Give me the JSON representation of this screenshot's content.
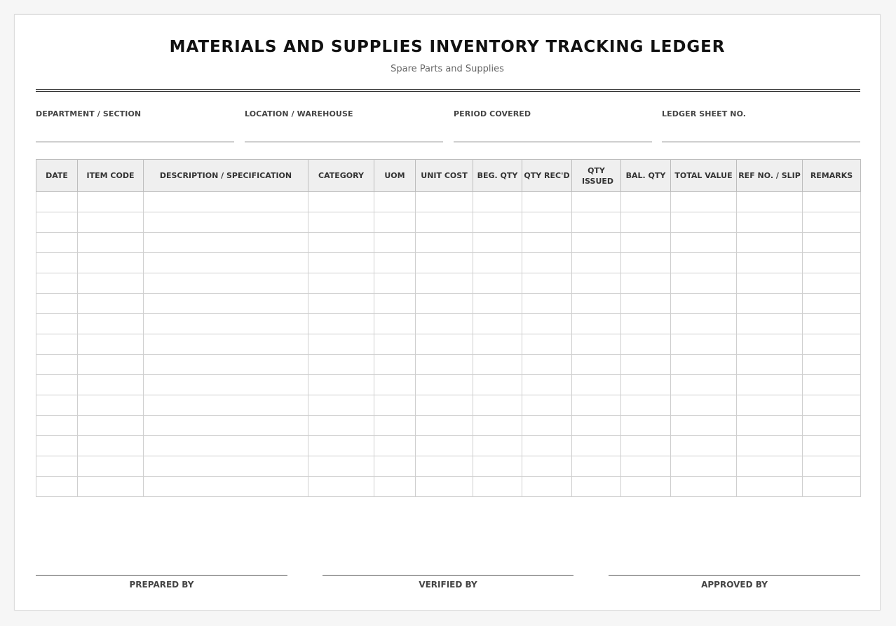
{
  "document": {
    "title": "MATERIALS AND SUPPLIES INVENTORY TRACKING LEDGER",
    "subtitle": "Spare Parts and Supplies"
  },
  "fields": [
    {
      "label": "DEPARTMENT / SECTION",
      "value": ""
    },
    {
      "label": "LOCATION / WAREHOUSE",
      "value": ""
    },
    {
      "label": "PERIOD COVERED",
      "value": ""
    },
    {
      "label": "LEDGER SHEET NO.",
      "value": ""
    }
  ],
  "table": {
    "columns": [
      "DATE",
      "ITEM CODE",
      "DESCRIPTION / SPECIFICATION",
      "CATEGORY",
      "UOM",
      "UNIT COST",
      "BEG. QTY",
      "QTY REC'D",
      "QTY ISSUED",
      "BAL. QTY",
      "TOTAL VALUE",
      "REF NO. / SLIP",
      "REMARKS"
    ],
    "rows": [
      [
        "",
        "",
        "",
        "",
        "",
        "",
        "",
        "",
        "",
        "",
        "",
        "",
        ""
      ],
      [
        "",
        "",
        "",
        "",
        "",
        "",
        "",
        "",
        "",
        "",
        "",
        "",
        ""
      ],
      [
        "",
        "",
        "",
        "",
        "",
        "",
        "",
        "",
        "",
        "",
        "",
        "",
        ""
      ],
      [
        "",
        "",
        "",
        "",
        "",
        "",
        "",
        "",
        "",
        "",
        "",
        "",
        ""
      ],
      [
        "",
        "",
        "",
        "",
        "",
        "",
        "",
        "",
        "",
        "",
        "",
        "",
        ""
      ],
      [
        "",
        "",
        "",
        "",
        "",
        "",
        "",
        "",
        "",
        "",
        "",
        "",
        ""
      ],
      [
        "",
        "",
        "",
        "",
        "",
        "",
        "",
        "",
        "",
        "",
        "",
        "",
        ""
      ],
      [
        "",
        "",
        "",
        "",
        "",
        "",
        "",
        "",
        "",
        "",
        "",
        "",
        ""
      ],
      [
        "",
        "",
        "",
        "",
        "",
        "",
        "",
        "",
        "",
        "",
        "",
        "",
        ""
      ],
      [
        "",
        "",
        "",
        "",
        "",
        "",
        "",
        "",
        "",
        "",
        "",
        "",
        ""
      ],
      [
        "",
        "",
        "",
        "",
        "",
        "",
        "",
        "",
        "",
        "",
        "",
        "",
        ""
      ],
      [
        "",
        "",
        "",
        "",
        "",
        "",
        "",
        "",
        "",
        "",
        "",
        "",
        ""
      ],
      [
        "",
        "",
        "",
        "",
        "",
        "",
        "",
        "",
        "",
        "",
        "",
        "",
        ""
      ],
      [
        "",
        "",
        "",
        "",
        "",
        "",
        "",
        "",
        "",
        "",
        "",
        "",
        ""
      ],
      [
        "",
        "",
        "",
        "",
        "",
        "",
        "",
        "",
        "",
        "",
        "",
        "",
        ""
      ]
    ]
  },
  "signatures": [
    {
      "label": "PREPARED BY"
    },
    {
      "label": "VERIFIED BY"
    },
    {
      "label": "APPROVED BY"
    }
  ],
  "colors": {
    "header_fill": "#efefef",
    "grid_line": "#cfcfcf",
    "title_text": "#111111"
  }
}
